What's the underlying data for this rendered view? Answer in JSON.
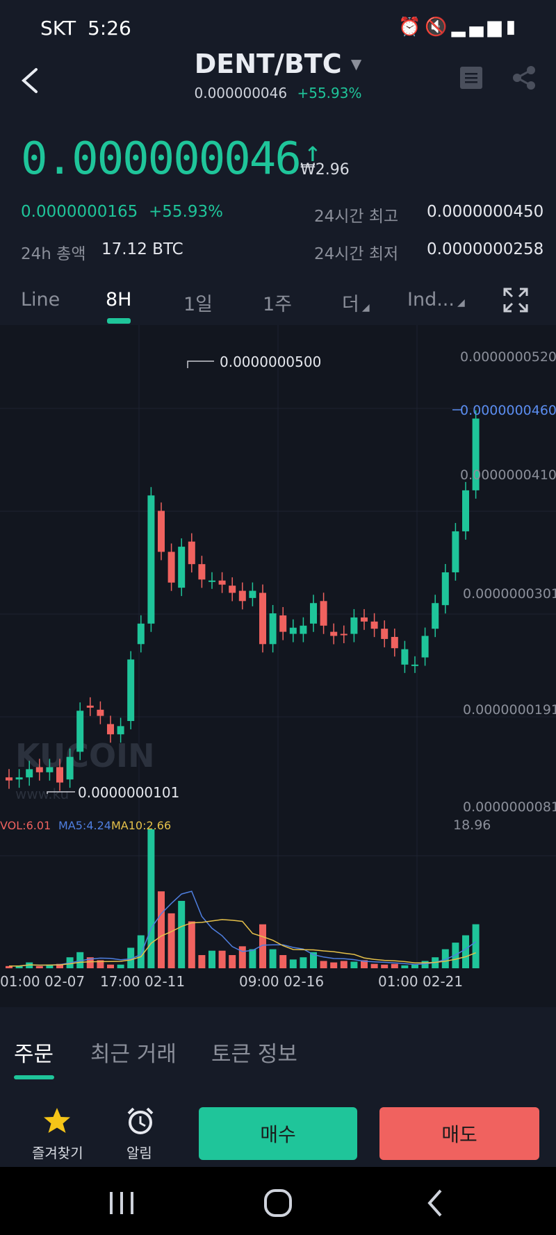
{
  "status_bar": {
    "carrier": "SKT",
    "time": "5:26"
  },
  "header": {
    "pair": "DENT/BTC",
    "sub_price": "0.000000046",
    "sub_change": "+55.93%"
  },
  "price": {
    "last": "0.000000046",
    "krw": "₩2.96",
    "low_price": "0.0000000165",
    "change": "+55.93%",
    "vol_label": "24h 총액",
    "vol_value": "17.12  BTC",
    "high_label": "24시간 최고",
    "high_value": "0.0000000450",
    "low_label": "24시간 최저",
    "low_value": "0.0000000258"
  },
  "timeframes": [
    {
      "label": "Line"
    },
    {
      "label": "8H"
    },
    {
      "label": "1일"
    },
    {
      "label": "1주"
    },
    {
      "label": "더"
    },
    {
      "label": "Ind..."
    }
  ],
  "chart_labels": {
    "y_ticks": [
      "0.0000000520",
      "0.0000000410",
      "0.0000000301",
      "0.0000000191",
      "0.0000000081"
    ],
    "current": "0.0000000460",
    "max_label": "0.0000000500",
    "min_label": "0.0000000101",
    "watermark": "KUCOIN",
    "watermark_url": "www.ku",
    "vol": "VOL:6.01",
    "ma5": "MA5:4.24",
    "ma10": "MA10:2.66",
    "vol_max": "18.96",
    "x_ticks": [
      "01:00 02-07",
      "17:00 02-11",
      "09:00 02-16",
      "01:00 02-21"
    ]
  },
  "bottom_tabs": [
    {
      "label": "주문"
    },
    {
      "label": "최근 거래"
    },
    {
      "label": "토큰 정보"
    }
  ],
  "actions": {
    "favorite": "즐겨찾기",
    "alarm": "알림",
    "buy": "매수",
    "sell": "매도"
  },
  "colors": {
    "up": "#1fc59a",
    "down": "#f0625f",
    "ma5": "#4f7fe0",
    "ma10": "#e6c14a",
    "bg": "#161b27"
  },
  "chart_data": {
    "type": "candlestick",
    "ylim": [
      8.1e-09,
      5.2e-08
    ],
    "candles": [
      {
        "o": 1.1e-08,
        "c": 1.07e-08
      },
      {
        "o": 1.08e-08,
        "c": 1.1e-08
      },
      {
        "o": 1.1e-08,
        "c": 1.18e-08
      },
      {
        "o": 1.2e-08,
        "c": 1.15e-08
      },
      {
        "o": 1.15e-08,
        "c": 1.2e-08
      },
      {
        "o": 1.2e-08,
        "c": 1.05e-08
      },
      {
        "o": 1.08e-08,
        "c": 1.3e-08
      },
      {
        "o": 1.35e-08,
        "c": 1.75e-08
      },
      {
        "o": 1.8e-08,
        "c": 1.78e-08
      },
      {
        "o": 1.76e-08,
        "c": 1.7e-08
      },
      {
        "o": 1.62e-08,
        "c": 1.52e-08
      },
      {
        "o": 1.52e-08,
        "c": 1.6e-08
      },
      {
        "o": 1.65e-08,
        "c": 2.25e-08
      },
      {
        "o": 2.4e-08,
        "c": 2.6e-08
      },
      {
        "o": 2.6e-08,
        "c": 3.85e-08
      },
      {
        "o": 3.7e-08,
        "c": 3.3e-08
      },
      {
        "o": 3.3e-08,
        "c": 3e-08
      },
      {
        "o": 2.95e-08,
        "c": 3.35e-08
      },
      {
        "o": 3.4e-08,
        "c": 3.18e-08
      },
      {
        "o": 3.18e-08,
        "c": 3.03e-08
      },
      {
        "o": 3.02e-08,
        "c": 3.02e-08
      },
      {
        "o": 3.02e-08,
        "c": 2.98e-08
      },
      {
        "o": 2.97e-08,
        "c": 2.9e-08
      },
      {
        "o": 2.92e-08,
        "c": 2.82e-08
      },
      {
        "o": 2.85e-08,
        "c": 2.92e-08
      },
      {
        "o": 2.9e-08,
        "c": 2.4e-08
      },
      {
        "o": 2.4e-08,
        "c": 2.7e-08
      },
      {
        "o": 2.68e-08,
        "c": 2.52e-08
      },
      {
        "o": 2.5e-08,
        "c": 2.56e-08
      },
      {
        "o": 2.5e-08,
        "c": 2.58e-08
      },
      {
        "o": 2.6e-08,
        "c": 2.8e-08
      },
      {
        "o": 2.82e-08,
        "c": 2.58e-08
      },
      {
        "o": 2.52e-08,
        "c": 2.48e-08
      },
      {
        "o": 2.5e-08,
        "c": 2.49e-08
      },
      {
        "o": 2.5e-08,
        "c": 2.66e-08
      },
      {
        "o": 2.66e-08,
        "c": 2.62e-08
      },
      {
        "o": 2.62e-08,
        "c": 2.55e-08
      },
      {
        "o": 2.55e-08,
        "c": 2.45e-08
      },
      {
        "o": 2.47e-08,
        "c": 2.36e-08
      },
      {
        "o": 2.2e-08,
        "c": 2.35e-08
      },
      {
        "o": 2.2e-08,
        "c": 2.2e-08
      },
      {
        "o": 2.27e-08,
        "c": 2.48e-08
      },
      {
        "o": 2.55e-08,
        "c": 2.8e-08
      },
      {
        "o": 2.78e-08,
        "c": 3.1e-08
      },
      {
        "o": 3.1e-08,
        "c": 3.5e-08
      },
      {
        "o": 3.5e-08,
        "c": 3.9e-08
      },
      {
        "o": 3.9e-08,
        "c": 4.6e-08
      }
    ],
    "volume": [
      0.3,
      0.3,
      0.8,
      0.3,
      0.5,
      0.6,
      1.5,
      2.2,
      1.5,
      1.1,
      0.5,
      0.5,
      2.8,
      4.5,
      18.96,
      10.5,
      7.5,
      9.2,
      6.4,
      1.8,
      2.4,
      2.4,
      1.8,
      3.0,
      2.6,
      6.0,
      2.6,
      1.8,
      1.2,
      1.5,
      2.2,
      1.0,
      0.8,
      1.0,
      0.9,
      1.1,
      0.6,
      0.5,
      0.6,
      0.4,
      0.5,
      1.0,
      1.5,
      2.6,
      3.5,
      4.5,
      6.01
    ],
    "x_tick_labels": [
      "01:00 02-07",
      "17:00 02-11",
      "09:00 02-16",
      "01:00 02-21"
    ]
  }
}
